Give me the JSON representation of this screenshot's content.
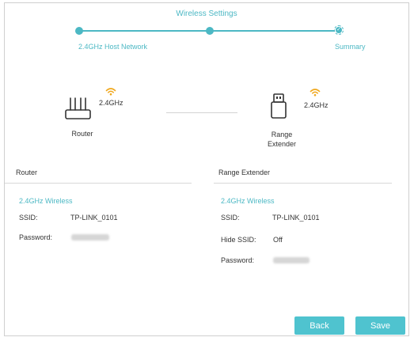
{
  "wizard": {
    "title": "Wireless Settings",
    "steps": [
      "2.4GHz Host Network",
      "Summary"
    ]
  },
  "topology": {
    "router_label": "Router",
    "router_band": "2.4GHz",
    "extender_label_line1": "Range",
    "extender_label_line2": "Extender",
    "extender_band": "2.4GHz"
  },
  "router": {
    "section_title": "Router",
    "band_title": "2.4GHz Wireless",
    "ssid_label": "SSID:",
    "ssid_value": "TP-LINK_0101",
    "password_label": "Password:"
  },
  "extender": {
    "section_title": "Range Extender",
    "band_title": "2.4GHz Wireless",
    "ssid_label": "SSID:",
    "ssid_value": "TP-LINK_0101",
    "hide_ssid_label": "Hide SSID:",
    "hide_ssid_value": "Off",
    "password_label": "Password:"
  },
  "buttons": {
    "back": "Back",
    "save": "Save"
  },
  "icons": [
    "wifi-icon",
    "router-icon",
    "usb-extender-icon",
    "check-icon"
  ],
  "colors": {
    "accent": "#4cb8c4",
    "button": "#4fc3cf",
    "wifi": "#f0a81e"
  }
}
